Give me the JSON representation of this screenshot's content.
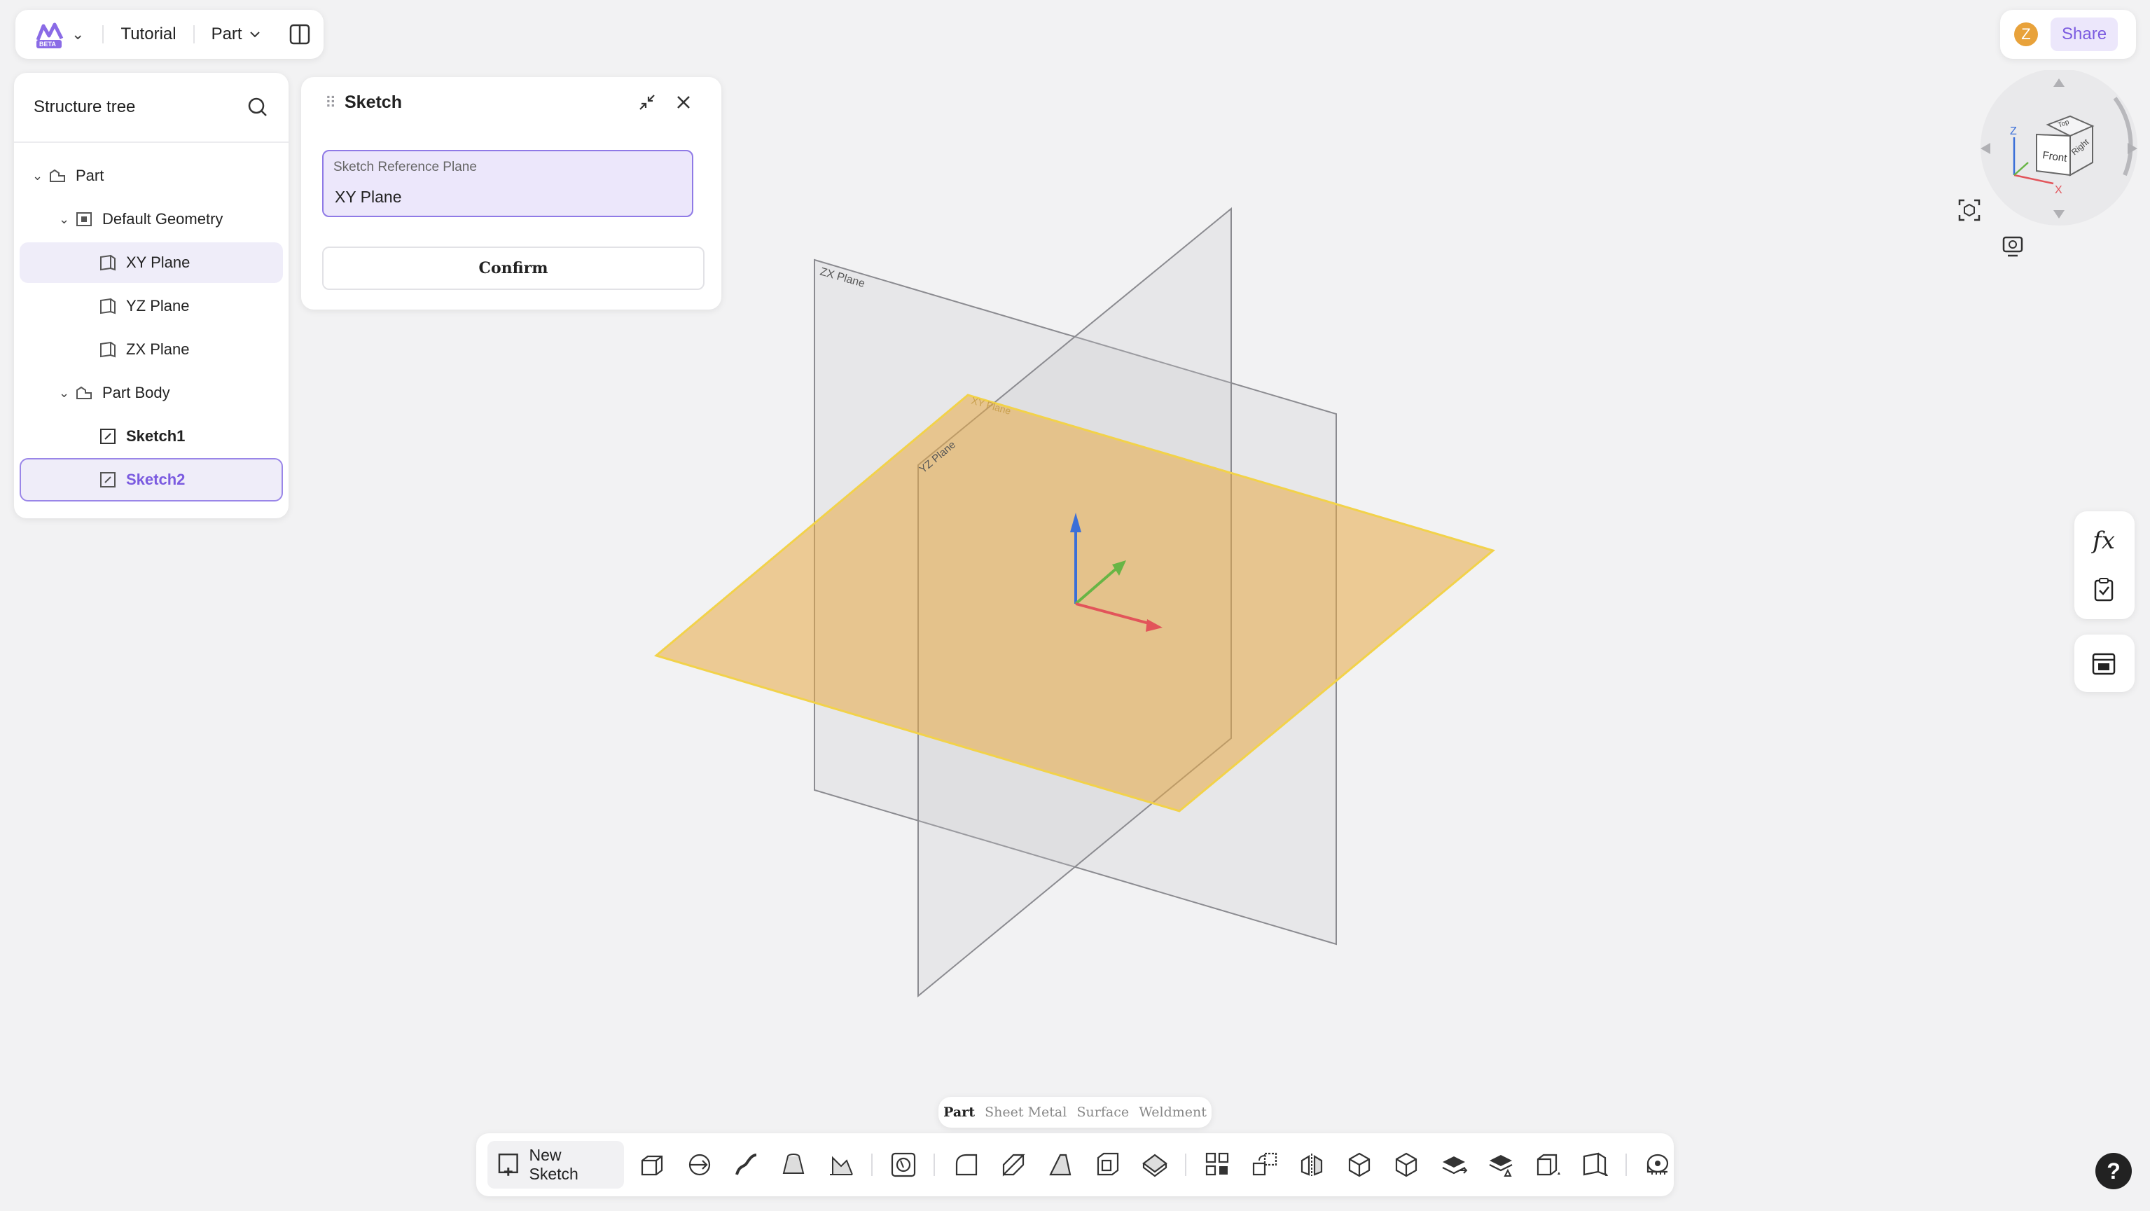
{
  "header": {
    "logo_badge": "BETA",
    "project_title": "Tutorial",
    "mode_label": "Part"
  },
  "user": {
    "avatar_initial": "Z",
    "share_label": "Share"
  },
  "structure_tree": {
    "title": "Structure tree",
    "items": [
      {
        "label": "Part"
      },
      {
        "label": "Default Geometry"
      },
      {
        "label": "XY Plane"
      },
      {
        "label": "YZ Plane"
      },
      {
        "label": "ZX Plane"
      },
      {
        "label": "Part Body"
      },
      {
        "label": "Sketch1"
      },
      {
        "label": "Sketch2"
      }
    ]
  },
  "sketch_dialog": {
    "title": "Sketch",
    "reference_plane_label": "Sketch Reference Plane",
    "reference_plane_value": "XY Plane",
    "confirm_label": "Confirm"
  },
  "viewport": {
    "zx_plane_label": "ZX Plane",
    "yz_plane_label": "YZ Plane",
    "xy_plane_label": "XY Plane",
    "accent_color": "#e8b35c"
  },
  "nav_cube": {
    "face_front": "Front",
    "face_top": "Top",
    "face_right": "Right",
    "axis_z": "Z",
    "axis_x": "X"
  },
  "bottom_tabs": [
    "Part",
    "Sheet Metal",
    "Surface",
    "Weldment"
  ],
  "toolbar": {
    "new_sketch_label": "New Sketch"
  },
  "help_label": "?"
}
